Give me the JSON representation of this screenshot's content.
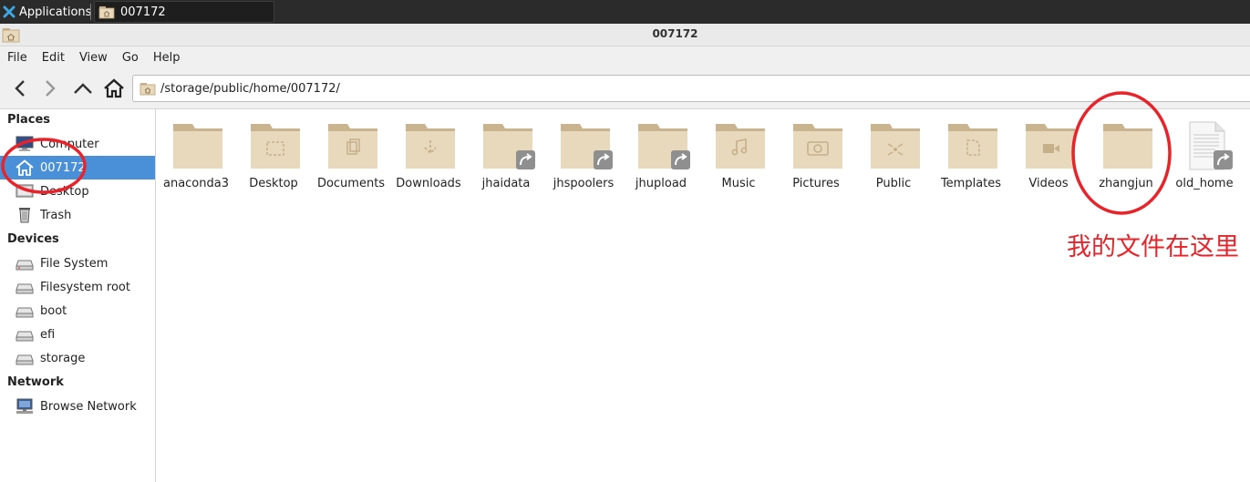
{
  "panel": {
    "applications_label": "Applications",
    "task_title": "007172"
  },
  "window": {
    "title": "007172"
  },
  "menu": [
    "File",
    "Edit",
    "View",
    "Go",
    "Help"
  ],
  "toolbar": {
    "back_icon": "chevron-left-icon",
    "forward_icon": "chevron-right-icon",
    "up_icon": "chevron-up-icon",
    "home_icon": "home-icon",
    "path": "/storage/public/home/007172/"
  },
  "sidebar": {
    "places_header": "Places",
    "places": [
      {
        "label": "Computer",
        "icon": "computer-icon"
      },
      {
        "label": "007172",
        "icon": "home-icon",
        "selected": true
      },
      {
        "label": "Desktop",
        "icon": "desktop-icon"
      },
      {
        "label": "Trash",
        "icon": "trash-icon"
      }
    ],
    "devices_header": "Devices",
    "devices": [
      {
        "label": "File System",
        "icon": "drive-icon"
      },
      {
        "label": "Filesystem root",
        "icon": "drive-icon"
      },
      {
        "label": "boot",
        "icon": "drive-icon"
      },
      {
        "label": "efi",
        "icon": "drive-icon"
      },
      {
        "label": "storage",
        "icon": "drive-icon"
      }
    ],
    "network_header": "Network",
    "network": [
      {
        "label": "Browse Network",
        "icon": "network-icon"
      }
    ]
  },
  "files": [
    {
      "name": "anaconda3",
      "icon": "folder-icon",
      "emblem": "none"
    },
    {
      "name": "Desktop",
      "icon": "folder-desktop-icon",
      "emblem": "none"
    },
    {
      "name": "Documents",
      "icon": "folder-documents-icon",
      "emblem": "none"
    },
    {
      "name": "Downloads",
      "icon": "folder-downloads-icon",
      "emblem": "none"
    },
    {
      "name": "jhaidata",
      "icon": "folder-icon",
      "emblem": "symlink"
    },
    {
      "name": "jhspoolers",
      "icon": "folder-icon",
      "emblem": "symlink"
    },
    {
      "name": "jhupload",
      "icon": "folder-icon",
      "emblem": "symlink"
    },
    {
      "name": "Music",
      "icon": "folder-music-icon",
      "emblem": "none"
    },
    {
      "name": "Pictures",
      "icon": "folder-pictures-icon",
      "emblem": "none"
    },
    {
      "name": "Public",
      "icon": "folder-public-icon",
      "emblem": "none"
    },
    {
      "name": "Templates",
      "icon": "folder-templates-icon",
      "emblem": "none"
    },
    {
      "name": "Videos",
      "icon": "folder-videos-icon",
      "emblem": "none"
    },
    {
      "name": "zhangjun",
      "icon": "folder-icon",
      "emblem": "none"
    },
    {
      "name": "old_home",
      "icon": "document-icon",
      "emblem": "symlink"
    }
  ],
  "annotation": {
    "note": "我的文件在这里",
    "color": "#e8232a"
  },
  "colors": {
    "selection": "#4a90d9",
    "folder_body": "#e8d8bc",
    "folder_tab": "#c9b48f"
  }
}
